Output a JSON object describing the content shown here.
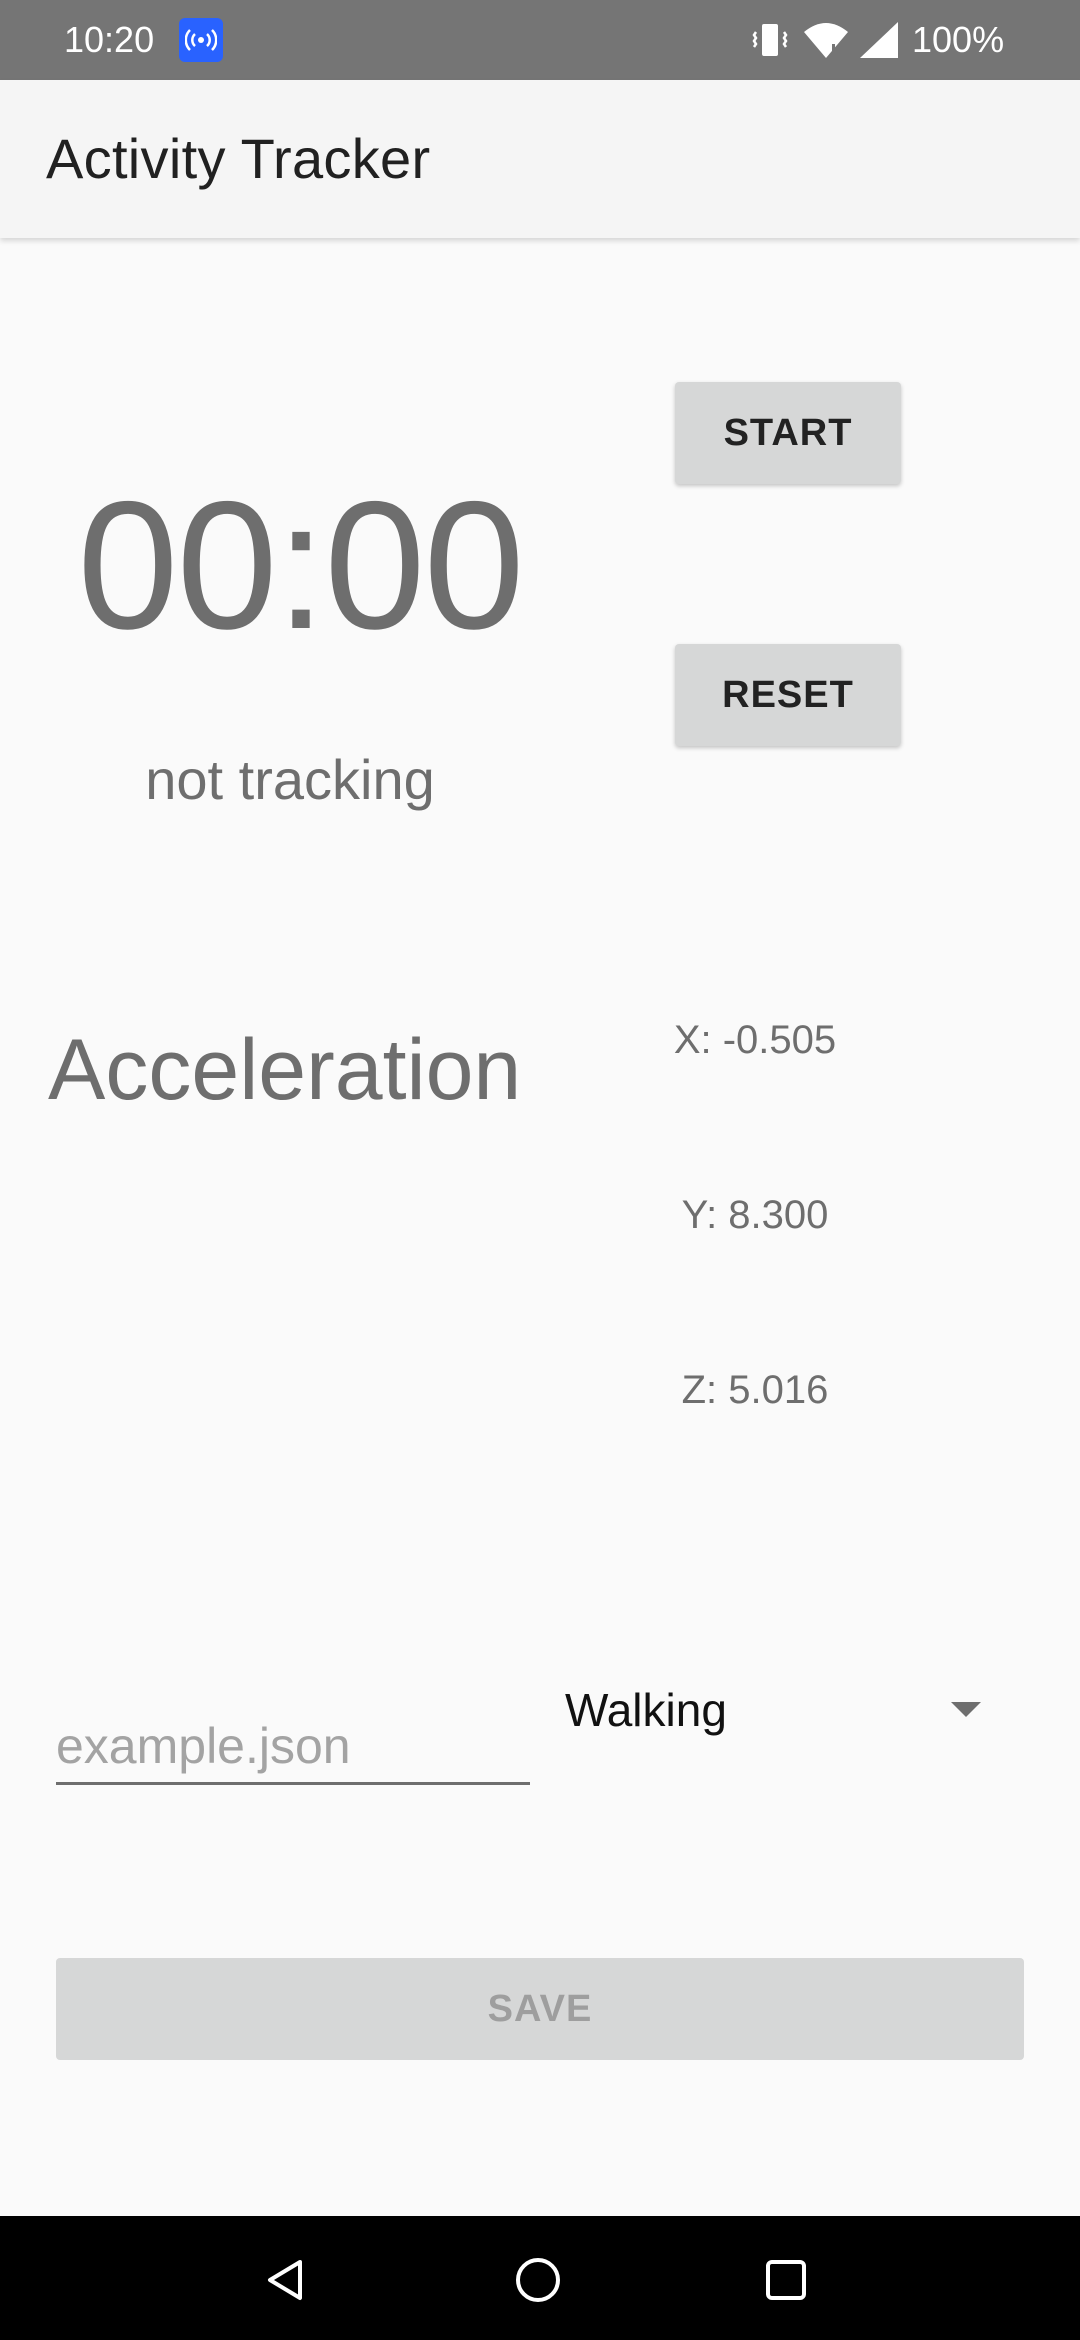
{
  "status_bar": {
    "time": "10:20",
    "battery": "100%",
    "icons": [
      "hotspot-icon",
      "vibrate-icon",
      "wifi-icon",
      "signal-icon"
    ],
    "background_color": "#757575"
  },
  "app_bar": {
    "title": "Activity Tracker"
  },
  "timer": {
    "start_label": "START",
    "reset_label": "RESET",
    "elapsed": "00:00",
    "status": "not tracking"
  },
  "acceleration": {
    "title": "Acceleration",
    "x": "X: -0.505",
    "y": "Y: 8.300",
    "z": "Z: 5.016"
  },
  "form": {
    "filename_value": "",
    "filename_placeholder": "example.json",
    "activity_selected": "Walking",
    "save_label": "SAVE"
  },
  "nav_bar": {
    "buttons": [
      "back-icon",
      "home-icon",
      "recents-icon"
    ]
  },
  "colors": {
    "button_bg": "#d6d7d7",
    "text_gray": "#6e6e6e",
    "app_bar_bg": "#f5f5f5"
  }
}
